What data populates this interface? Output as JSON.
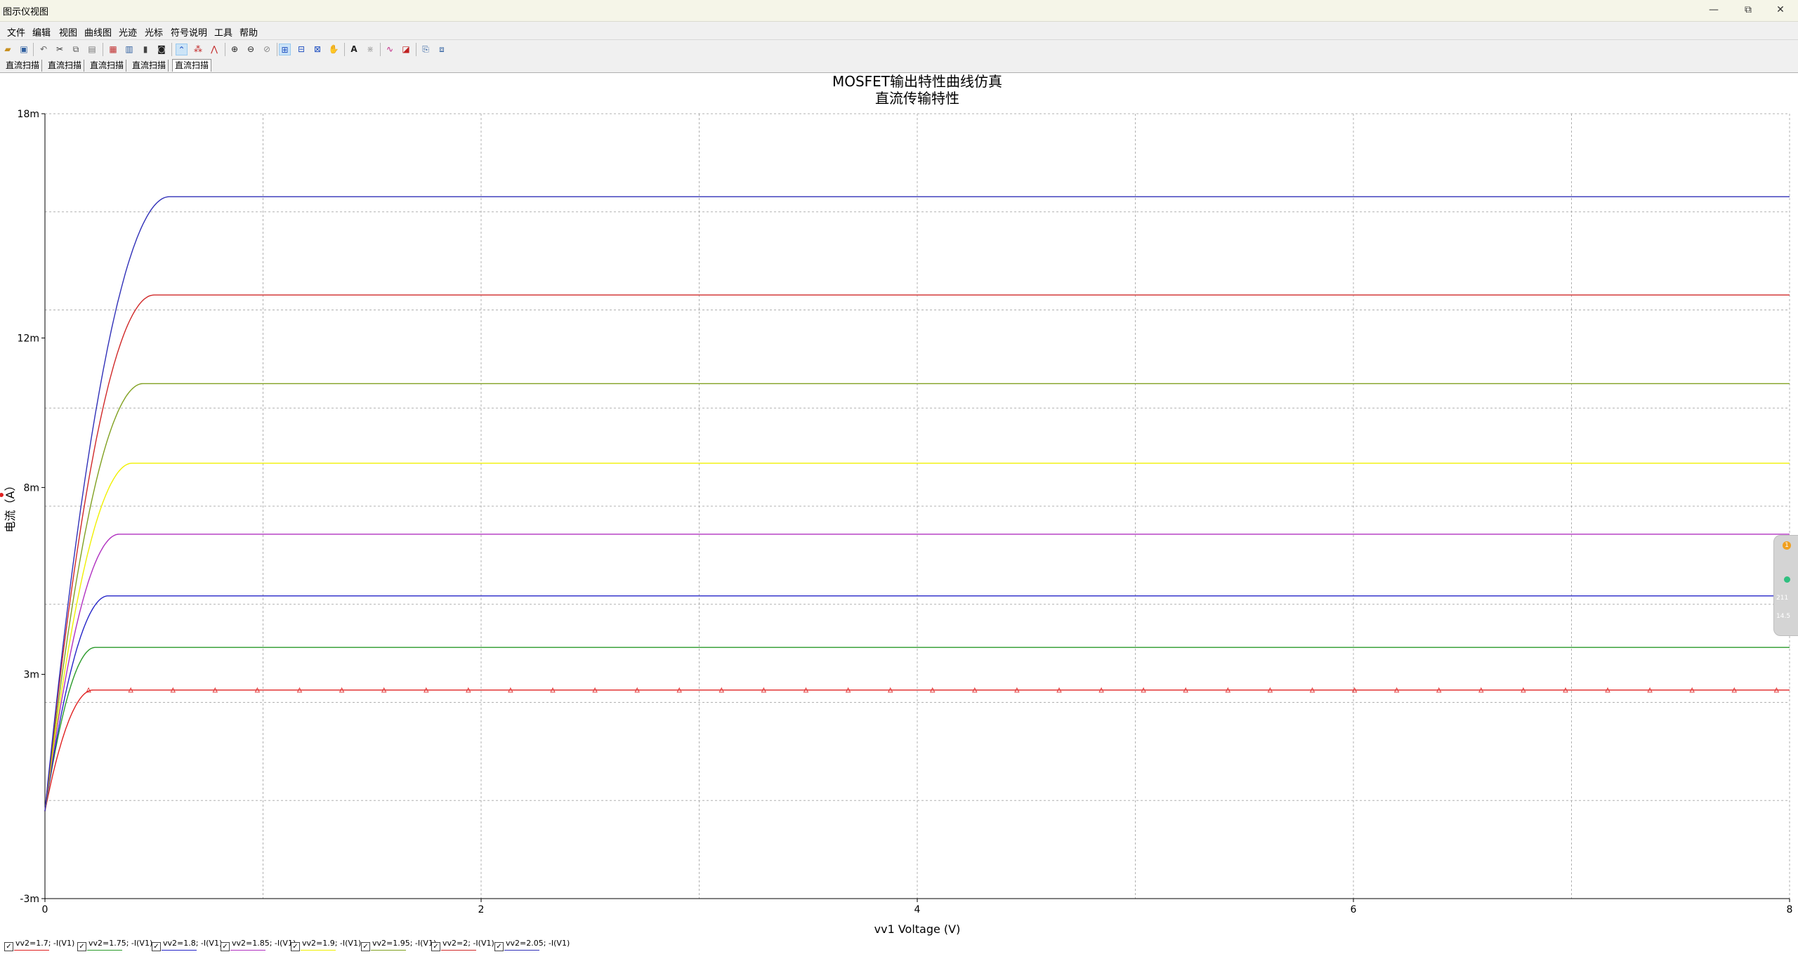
{
  "window": {
    "title": "图示仪视图",
    "minimize_icon": "—",
    "restore_icon": "⧉",
    "close_icon": "✕"
  },
  "menu": [
    "文件",
    "编辑",
    "视图",
    "曲线图",
    "光迹",
    "光标",
    "符号说明",
    "工具",
    "帮助"
  ],
  "toolbar": {
    "icons": [
      "open-icon",
      "save-icon",
      "undo-icon",
      "cut-icon",
      "copy-icon",
      "paste-icon",
      "grid-icon",
      "show-legend-icon",
      "bar-chart-icon",
      "export-icon",
      "cursor-line-icon",
      "cursor-point-icon",
      "cursor-peak-icon",
      "zoom-in-icon",
      "zoom-out-icon",
      "zoom-fit-icon",
      "zoom-x-icon",
      "zoom-y-icon",
      "zoom-area-icon",
      "pan-icon",
      "text-icon",
      "marker-icon",
      "trace-icon",
      "properties-icon",
      "copy-graph-icon",
      "overlay-icon"
    ]
  },
  "tabs": [
    {
      "label": "直流扫描"
    },
    {
      "label": "直流扫描"
    },
    {
      "label": "直流扫描"
    },
    {
      "label": "直流扫描"
    },
    {
      "label": "直流扫描"
    }
  ],
  "chart_data": {
    "type": "line",
    "title": "MOSFET输出特性曲线仿真",
    "subtitle": "直流传输特性",
    "xlabel": "vv1 Voltage (V)",
    "ylabel": "电流（A）",
    "xlim": [
      0,
      8
    ],
    "ylim": [
      -0.003,
      0.018
    ],
    "x_ticks": [
      0,
      2,
      4,
      6,
      8
    ],
    "x_tick_labels": [
      "0",
      "2",
      "4",
      "6",
      "8"
    ],
    "y_ticks": [
      -0.003,
      0.003,
      0.008,
      0.012,
      0.018
    ],
    "y_tick_labels": [
      "-3m",
      "3m",
      "8m",
      "12m",
      "18m"
    ],
    "grid": true,
    "legend_position": "bottom",
    "series": [
      {
        "name": "vv2=1.7; -I(V1)",
        "color": "#e02020",
        "start": 0.0,
        "sat": 0.00258,
        "vsat": 0.22,
        "markers": true
      },
      {
        "name": "vv2=1.75; -I(V1)",
        "color": "#2a9a2a",
        "start": 0.0,
        "sat": 0.00372,
        "vsat": 0.23,
        "markers": false
      },
      {
        "name": "vv2=1.8; -I(V1)",
        "color": "#2424c8",
        "start": 0.0,
        "sat": 0.0051,
        "vsat": 0.29,
        "markers": false
      },
      {
        "name": "vv2=1.85; -I(V1)",
        "color": "#b030c0",
        "start": 0.0,
        "sat": 0.00675,
        "vsat": 0.34,
        "markers": false
      },
      {
        "name": "vv2=1.9; -I(V1)",
        "color": "#f0f000",
        "start": 0.0,
        "sat": 0.00865,
        "vsat": 0.4,
        "markers": false
      },
      {
        "name": "vv2=1.95; -I(V1)",
        "color": "#80a020",
        "start": 0.0,
        "sat": 0.01078,
        "vsat": 0.45,
        "markers": false
      },
      {
        "name": "vv2=2; -I(V1)",
        "color": "#d02828",
        "start": 0.0,
        "sat": 0.01315,
        "vsat": 0.5,
        "markers": false
      },
      {
        "name": "vv2=2.05; -I(V1)",
        "color": "#3030b8",
        "start": 0.0,
        "sat": 0.01578,
        "vsat": 0.57,
        "markers": false
      }
    ]
  },
  "side_widget": {
    "badge": "1",
    "text1": "211",
    "text2": "14.5"
  }
}
